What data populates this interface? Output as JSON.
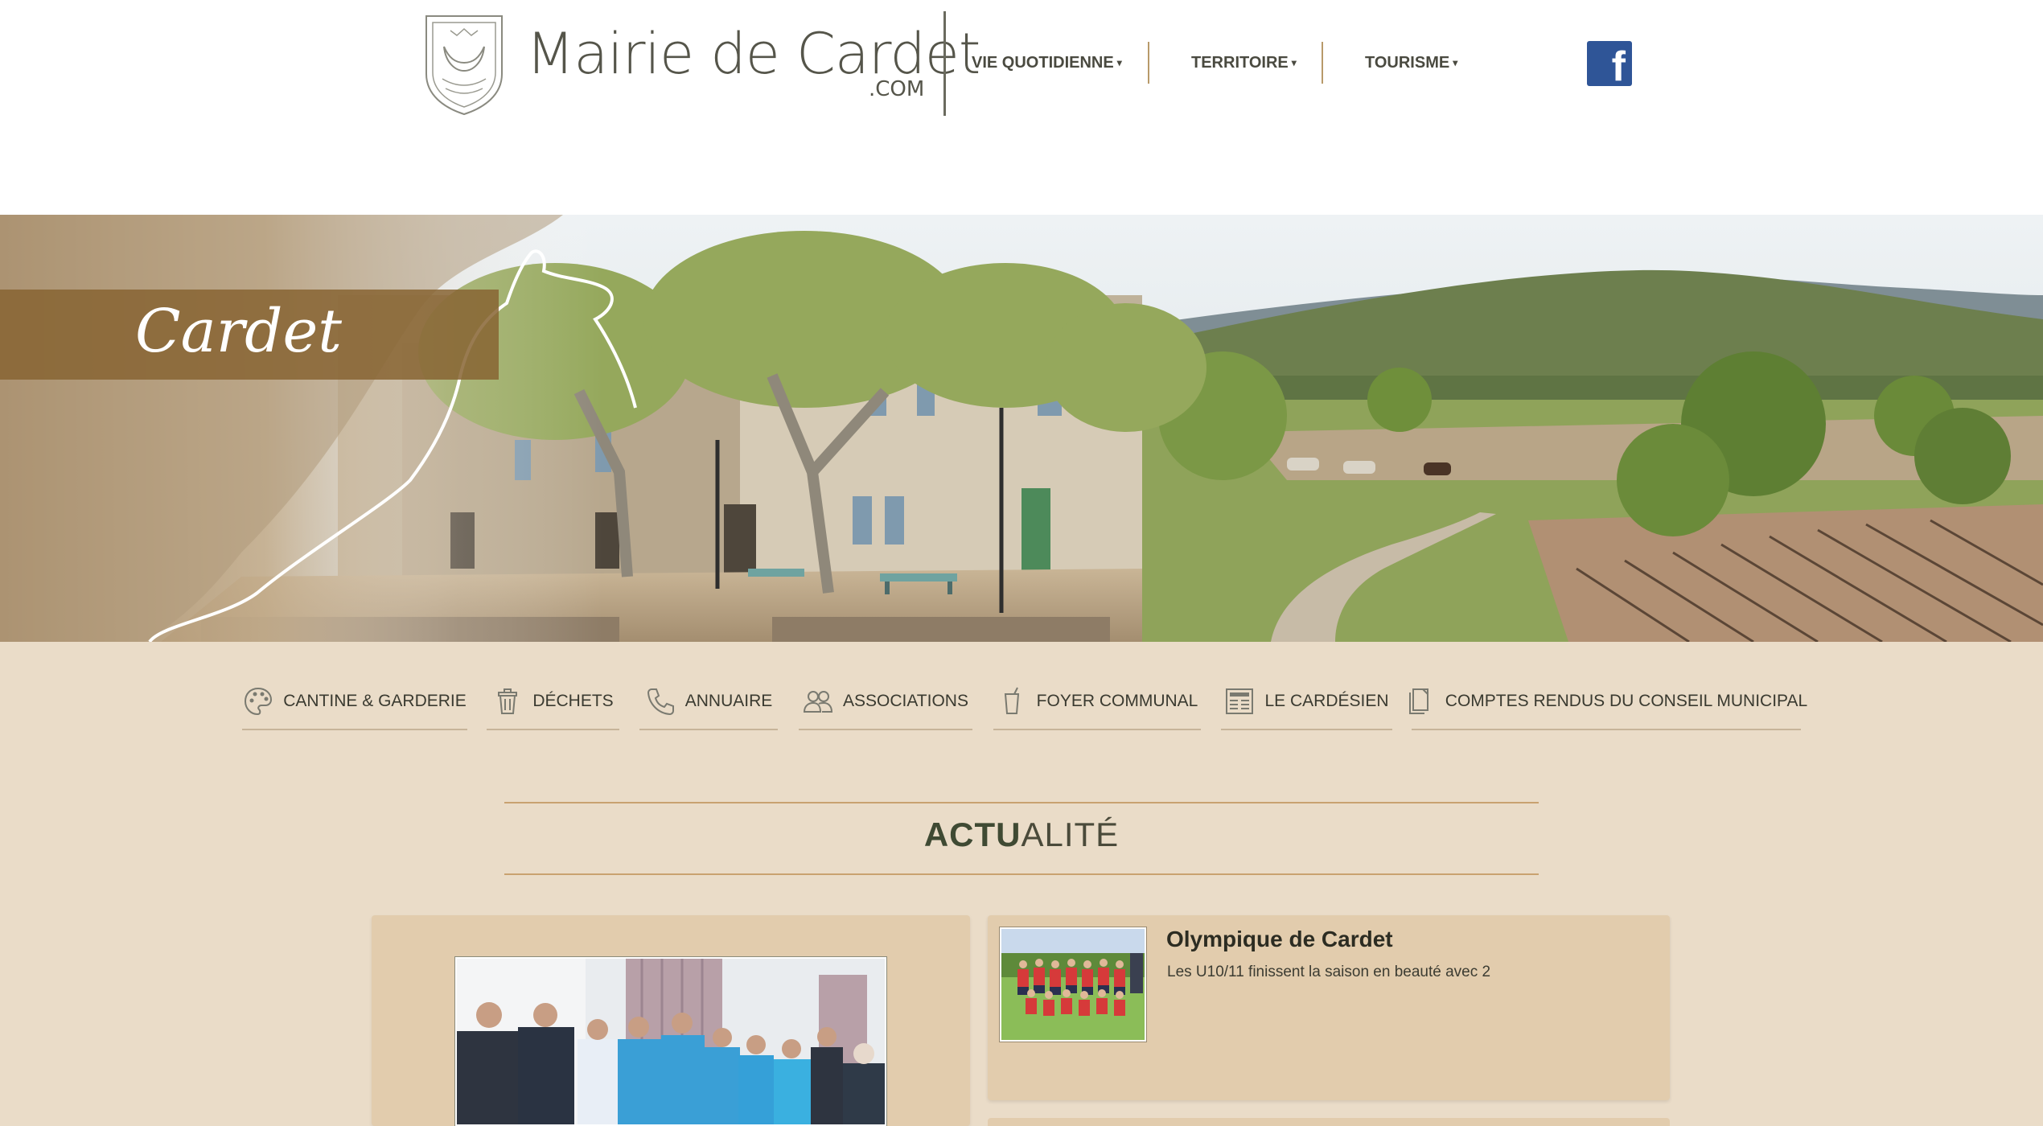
{
  "site": {
    "title": "Mairie de Cardet",
    "title_suffix": ".COM",
    "hero_script": "Cardet"
  },
  "nav": {
    "items": [
      {
        "label": "VIE QUOTIDIENNE"
      },
      {
        "label": "TERRITOIRE"
      },
      {
        "label": "TOURISME"
      }
    ],
    "facebook_icon": "facebook-icon",
    "facebook_color": "#2f5597"
  },
  "quick_links": [
    {
      "label": "CANTINE & GARDERIE",
      "icon": "palette-icon"
    },
    {
      "label": "DÉCHETS",
      "icon": "trash-icon"
    },
    {
      "label": "ANNUAIRE",
      "icon": "phone-icon"
    },
    {
      "label": "ASSOCIATIONS",
      "icon": "users-icon"
    },
    {
      "label": "FOYER COMMUNAL",
      "icon": "cup-icon"
    },
    {
      "label": "LE CARDÉSIEN",
      "icon": "newspaper-icon"
    },
    {
      "label": "COMPTES RENDUS DU CONSEIL MUNICIPAL",
      "icon": "document-icon"
    }
  ],
  "actualite": {
    "title_bold": "ACTU",
    "title_rest": "ALITÉ"
  },
  "news": [
    {
      "title": "Olympique de Cardet",
      "excerpt": "Les U10/11 finissent la saison en beauté avec 2"
    }
  ],
  "colors": {
    "page_bg": "#eadcc8",
    "card_bg": "#e2ccad",
    "accent_line": "#c9a270",
    "hero_band": "#876432"
  }
}
